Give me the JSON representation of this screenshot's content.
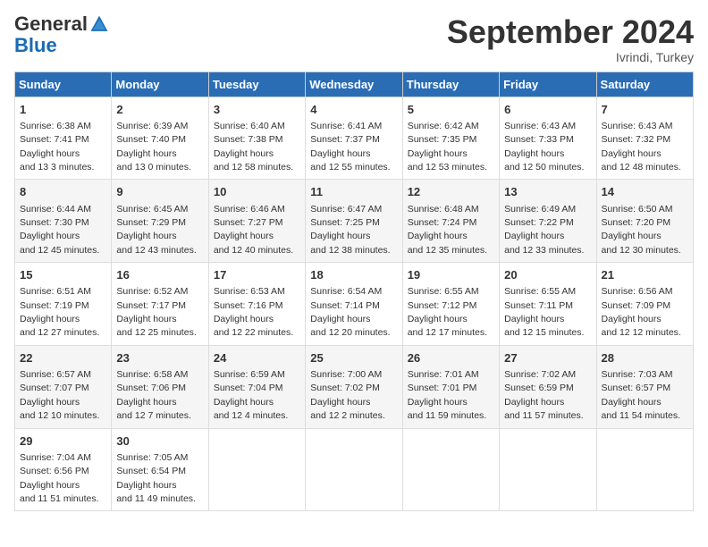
{
  "header": {
    "logo_general": "General",
    "logo_blue": "Blue",
    "title": "September 2024",
    "location": "Ivrindi, Turkey"
  },
  "days_of_week": [
    "Sunday",
    "Monday",
    "Tuesday",
    "Wednesday",
    "Thursday",
    "Friday",
    "Saturday"
  ],
  "weeks": [
    [
      {
        "day": "1",
        "sunrise": "6:38 AM",
        "sunset": "7:41 PM",
        "daylight": "13 hours and 3 minutes."
      },
      {
        "day": "2",
        "sunrise": "6:39 AM",
        "sunset": "7:40 PM",
        "daylight": "13 hours and 0 minutes."
      },
      {
        "day": "3",
        "sunrise": "6:40 AM",
        "sunset": "7:38 PM",
        "daylight": "12 hours and 58 minutes."
      },
      {
        "day": "4",
        "sunrise": "6:41 AM",
        "sunset": "7:37 PM",
        "daylight": "12 hours and 55 minutes."
      },
      {
        "day": "5",
        "sunrise": "6:42 AM",
        "sunset": "7:35 PM",
        "daylight": "12 hours and 53 minutes."
      },
      {
        "day": "6",
        "sunrise": "6:43 AM",
        "sunset": "7:33 PM",
        "daylight": "12 hours and 50 minutes."
      },
      {
        "day": "7",
        "sunrise": "6:43 AM",
        "sunset": "7:32 PM",
        "daylight": "12 hours and 48 minutes."
      }
    ],
    [
      {
        "day": "8",
        "sunrise": "6:44 AM",
        "sunset": "7:30 PM",
        "daylight": "12 hours and 45 minutes."
      },
      {
        "day": "9",
        "sunrise": "6:45 AM",
        "sunset": "7:29 PM",
        "daylight": "12 hours and 43 minutes."
      },
      {
        "day": "10",
        "sunrise": "6:46 AM",
        "sunset": "7:27 PM",
        "daylight": "12 hours and 40 minutes."
      },
      {
        "day": "11",
        "sunrise": "6:47 AM",
        "sunset": "7:25 PM",
        "daylight": "12 hours and 38 minutes."
      },
      {
        "day": "12",
        "sunrise": "6:48 AM",
        "sunset": "7:24 PM",
        "daylight": "12 hours and 35 minutes."
      },
      {
        "day": "13",
        "sunrise": "6:49 AM",
        "sunset": "7:22 PM",
        "daylight": "12 hours and 33 minutes."
      },
      {
        "day": "14",
        "sunrise": "6:50 AM",
        "sunset": "7:20 PM",
        "daylight": "12 hours and 30 minutes."
      }
    ],
    [
      {
        "day": "15",
        "sunrise": "6:51 AM",
        "sunset": "7:19 PM",
        "daylight": "12 hours and 27 minutes."
      },
      {
        "day": "16",
        "sunrise": "6:52 AM",
        "sunset": "7:17 PM",
        "daylight": "12 hours and 25 minutes."
      },
      {
        "day": "17",
        "sunrise": "6:53 AM",
        "sunset": "7:16 PM",
        "daylight": "12 hours and 22 minutes."
      },
      {
        "day": "18",
        "sunrise": "6:54 AM",
        "sunset": "7:14 PM",
        "daylight": "12 hours and 20 minutes."
      },
      {
        "day": "19",
        "sunrise": "6:55 AM",
        "sunset": "7:12 PM",
        "daylight": "12 hours and 17 minutes."
      },
      {
        "day": "20",
        "sunrise": "6:55 AM",
        "sunset": "7:11 PM",
        "daylight": "12 hours and 15 minutes."
      },
      {
        "day": "21",
        "sunrise": "6:56 AM",
        "sunset": "7:09 PM",
        "daylight": "12 hours and 12 minutes."
      }
    ],
    [
      {
        "day": "22",
        "sunrise": "6:57 AM",
        "sunset": "7:07 PM",
        "daylight": "12 hours and 10 minutes."
      },
      {
        "day": "23",
        "sunrise": "6:58 AM",
        "sunset": "7:06 PM",
        "daylight": "12 hours and 7 minutes."
      },
      {
        "day": "24",
        "sunrise": "6:59 AM",
        "sunset": "7:04 PM",
        "daylight": "12 hours and 4 minutes."
      },
      {
        "day": "25",
        "sunrise": "7:00 AM",
        "sunset": "7:02 PM",
        "daylight": "12 hours and 2 minutes."
      },
      {
        "day": "26",
        "sunrise": "7:01 AM",
        "sunset": "7:01 PM",
        "daylight": "11 hours and 59 minutes."
      },
      {
        "day": "27",
        "sunrise": "7:02 AM",
        "sunset": "6:59 PM",
        "daylight": "11 hours and 57 minutes."
      },
      {
        "day": "28",
        "sunrise": "7:03 AM",
        "sunset": "6:57 PM",
        "daylight": "11 hours and 54 minutes."
      }
    ],
    [
      {
        "day": "29",
        "sunrise": "7:04 AM",
        "sunset": "6:56 PM",
        "daylight": "11 hours and 51 minutes."
      },
      {
        "day": "30",
        "sunrise": "7:05 AM",
        "sunset": "6:54 PM",
        "daylight": "11 hours and 49 minutes."
      },
      null,
      null,
      null,
      null,
      null
    ]
  ]
}
